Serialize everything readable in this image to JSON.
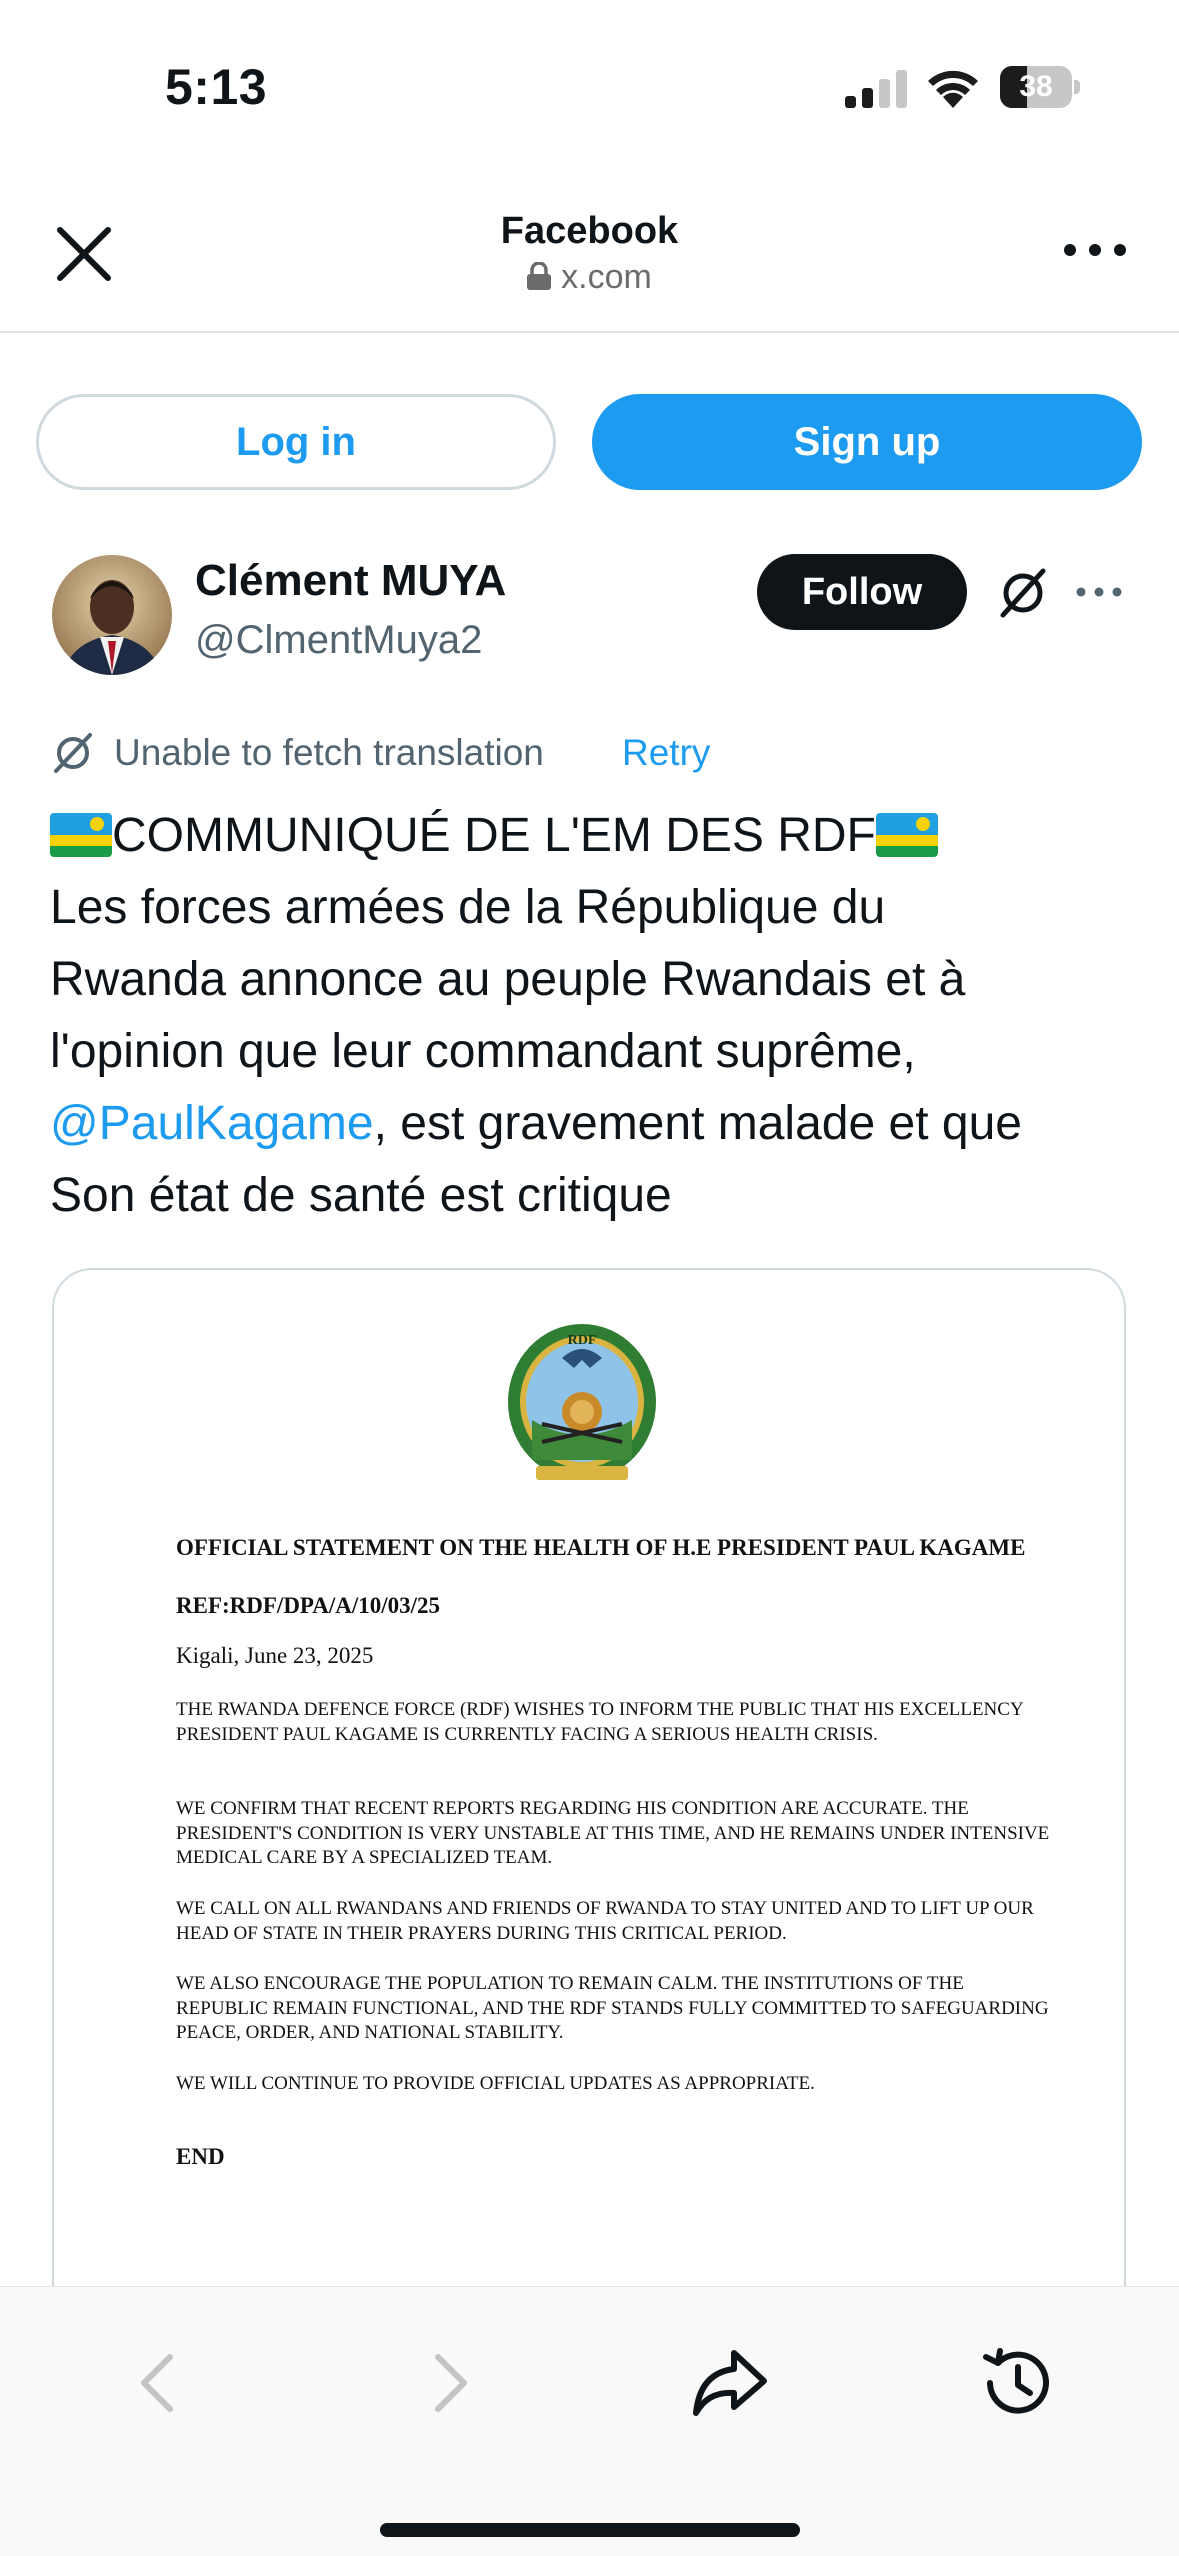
{
  "status_bar": {
    "time": "5:13",
    "battery": "38",
    "battery_level": 0.38
  },
  "browser": {
    "title": "Facebook",
    "url": "x.com"
  },
  "auth": {
    "login_label": "Log in",
    "signup_label": "Sign up"
  },
  "tweet": {
    "display_name": "Clément MUYA",
    "handle": "@ClmentMuya2",
    "follow_label": "Follow",
    "translation_message": "Unable to fetch translation",
    "retry_label": "Retry",
    "text": {
      "line1": "COMMUNIQUÉ DE L'EM DES RDF",
      "line2": "Les forces armées de la République du",
      "line3": "Rwanda annonce au peuple Rwandais et à",
      "line4": "l'opinion que leur commandant suprême,",
      "mention": "@PaulKagame",
      "line5_rest": ", est gravement malade et que",
      "line6": "Son état de santé est critique"
    }
  },
  "document": {
    "emblem_text": "RDF",
    "title": "OFFICIAL STATEMENT ON THE HEALTH OF H.E PRESIDENT PAUL KAGAME",
    "ref": "REF:RDF/DPA/A/10/03/25",
    "date": "Kigali, June 23, 2025",
    "paragraphs": [
      "THE RWANDA DEFENCE FORCE (RDF) WISHES TO INFORM THE PUBLIC THAT HIS EXCELLENCY PRESIDENT PAUL KAGAME IS CURRENTLY FACING A SERIOUS HEALTH CRISIS.",
      "WE CONFIRM THAT RECENT REPORTS REGARDING HIS CONDITION ARE ACCURATE. THE PRESIDENT'S CONDITION IS VERY UNSTABLE AT THIS TIME, AND HE REMAINS UNDER INTENSIVE MEDICAL CARE BY A SPECIALIZED TEAM.",
      "WE CALL ON ALL RWANDANS AND FRIENDS OF RWANDA TO STAY UNITED AND TO LIFT UP OUR HEAD OF STATE IN THEIR PRAYERS DURING THIS CRITICAL PERIOD.",
      "WE ALSO ENCOURAGE THE POPULATION TO REMAIN CALM. THE INSTITUTIONS OF THE REPUBLIC REMAIN FUNCTIONAL, AND THE RDF STANDS FULLY COMMITTED TO SAFEGUARDING PEACE, ORDER, AND NATIONAL STABILITY.",
      "WE WILL CONTINUE TO PROVIDE OFFICIAL UPDATES AS APPROPRIATE."
    ],
    "end": "END"
  },
  "icons": {
    "close": "close-icon",
    "lock": "lock-icon",
    "more": "more-horizontal-icon",
    "translate_off": "translate-off-icon",
    "back": "chevron-left-icon",
    "forward": "chevron-right-icon",
    "share": "share-icon",
    "history": "history-icon"
  },
  "colors": {
    "accent": "#1d9bf0",
    "follow_bg": "#0f1419",
    "muted": "#536471"
  }
}
